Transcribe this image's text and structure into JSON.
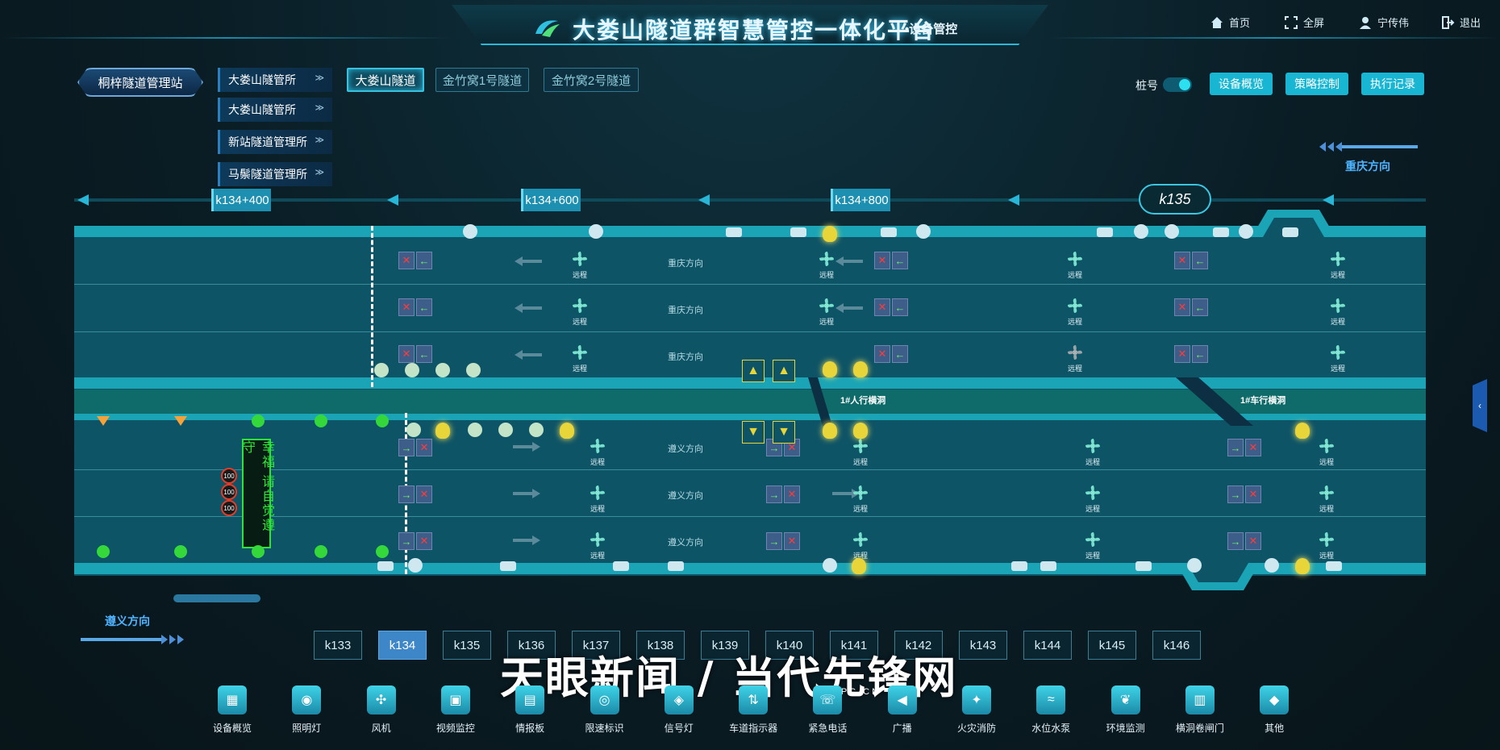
{
  "header": {
    "title": "大娄山隧道群智慧管控一体化平台",
    "subtitle": "•设备管控",
    "nav": [
      {
        "label": "首页",
        "icon": "home-icon"
      },
      {
        "label": "全屏",
        "icon": "fullscreen-icon"
      },
      {
        "label": "宁传伟",
        "icon": "user-icon"
      },
      {
        "label": "退出",
        "icon": "logout-icon"
      }
    ]
  },
  "station": {
    "label": "桐梓隧道管理站"
  },
  "managers": [
    {
      "label": "大娄山隧管所"
    },
    {
      "label": "大娄山隧管所"
    },
    {
      "label": "新站隧道管理所"
    },
    {
      "label": "马鬃隧道管理所"
    }
  ],
  "tunnels": [
    {
      "label": "大娄山隧道",
      "active": true
    },
    {
      "label": "金竹窝1号隧道",
      "active": false
    },
    {
      "label": "金竹窝2号隧道",
      "active": false
    }
  ],
  "controls": {
    "pile_label": "桩号",
    "pile_toggle_on": true,
    "buttons": [
      {
        "label": "设备概览"
      },
      {
        "label": "策略控制"
      },
      {
        "label": "执行记录"
      }
    ]
  },
  "directions": {
    "right": "重庆方向",
    "left": "遵义方向"
  },
  "km_markers": [
    "k134+400",
    "k134+600",
    "k134+800"
  ],
  "km_current": "k135",
  "tunnel": {
    "upper_dir": "重庆方向",
    "lower_dir": "遵义方向",
    "fan_label": "远程",
    "crossings": [
      "1#人行横洞",
      "1#车行横洞"
    ],
    "vms_text": "幸福 请自觉遵守",
    "speed_limits": [
      "100",
      "100",
      "100"
    ]
  },
  "km_tabs": [
    {
      "label": "k133",
      "active": false
    },
    {
      "label": "k134",
      "active": true
    },
    {
      "label": "k135",
      "active": false
    },
    {
      "label": "k136",
      "active": false
    },
    {
      "label": "k137",
      "active": false
    },
    {
      "label": "k138",
      "active": false
    },
    {
      "label": "k139",
      "active": false
    },
    {
      "label": "k140",
      "active": false
    },
    {
      "label": "k141",
      "active": false
    },
    {
      "label": "k142",
      "active": false
    },
    {
      "label": "k143",
      "active": false
    },
    {
      "label": "k144",
      "active": false
    },
    {
      "label": "k145",
      "active": false
    },
    {
      "label": "k146",
      "active": false
    }
  ],
  "toolbar": [
    {
      "label": "设备概览",
      "icon": "grid-icon"
    },
    {
      "label": "照明灯",
      "icon": "bulb-icon"
    },
    {
      "label": "风机",
      "icon": "fan-icon"
    },
    {
      "label": "视频监控",
      "icon": "camera-icon"
    },
    {
      "label": "情报板",
      "icon": "board-icon"
    },
    {
      "label": "限速标识",
      "icon": "speed-icon"
    },
    {
      "label": "信号灯",
      "icon": "signal-icon"
    },
    {
      "label": "车道指示器",
      "icon": "lane-icon"
    },
    {
      "label": "紧急电话",
      "icon": "phone-icon"
    },
    {
      "label": "广播",
      "icon": "speaker-icon"
    },
    {
      "label": "火灾消防",
      "icon": "fire-icon"
    },
    {
      "label": "水位水泵",
      "icon": "water-icon"
    },
    {
      "label": "环境监测",
      "icon": "leaf-icon"
    },
    {
      "label": "横洞卷闸门",
      "icon": "door-icon"
    },
    {
      "label": "其他",
      "icon": "layers-icon"
    }
  ],
  "watermark": {
    "text": "天眼新闻 / 当代先锋网",
    "sub": "DDCPC.CN"
  },
  "colors": {
    "accent": "#18b6d2",
    "tunnel": "#0e5467",
    "active_tab": "#3d86c8"
  }
}
